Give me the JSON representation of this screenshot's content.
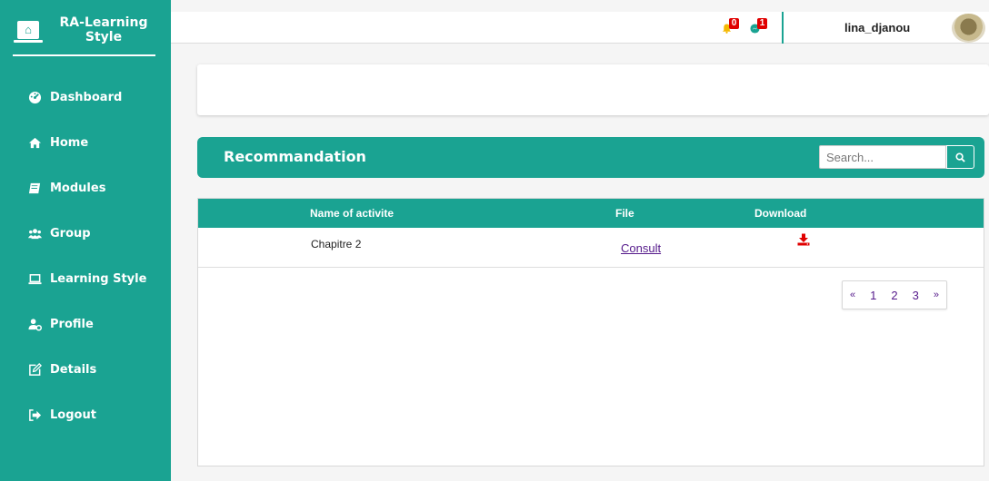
{
  "brand": {
    "name": "RA-Learning Style"
  },
  "sidebar": {
    "items": [
      {
        "label": "Dashboard",
        "icon": "tachometer-icon"
      },
      {
        "label": "Home",
        "icon": "home-icon"
      },
      {
        "label": "Modules",
        "icon": "book-icon"
      },
      {
        "label": "Group",
        "icon": "users-icon"
      },
      {
        "label": "Learning Style",
        "icon": "laptop-icon"
      },
      {
        "label": "Profile",
        "icon": "user-cog-icon"
      },
      {
        "label": "Details",
        "icon": "edit-icon"
      },
      {
        "label": "Logout",
        "icon": "sign-out-icon"
      }
    ]
  },
  "topbar": {
    "notifications_count": "0",
    "messages_count": "1",
    "username": "lina_djanou"
  },
  "recommendation": {
    "title": "Recommandation",
    "search_placeholder": "Search..."
  },
  "table": {
    "headers": {
      "name": "Name of activite",
      "file": "File",
      "download": "Download"
    },
    "rows": [
      {
        "name": "Chapitre 2",
        "file_link": "Consult"
      }
    ]
  },
  "pagination": {
    "prev": "«",
    "pages": [
      "1",
      "2",
      "3"
    ],
    "next": "»"
  },
  "colors": {
    "accent": "#1aa392",
    "badge": "#e00000",
    "download_icon": "#e00000",
    "link": "#551a8b"
  }
}
